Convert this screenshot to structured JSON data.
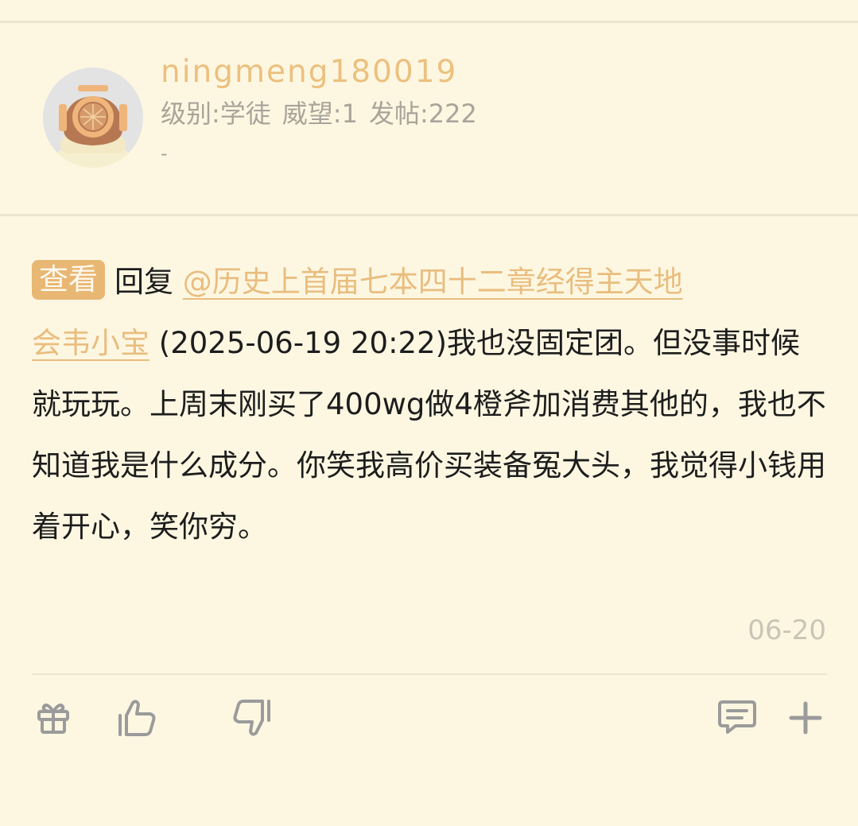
{
  "user": {
    "name": "ningmeng180019",
    "level": "级别:学徒",
    "prestige": "威望:1",
    "posts": "发帖:222",
    "signature": "-"
  },
  "post": {
    "view_label": "查看",
    "reply_label": "回复",
    "mention_line1": "@历史上首届七本四十二章经得主天地",
    "mention_line2": "会韦小宝",
    "quote_time": " (2025-06-19 20:22)",
    "body": "我也没固定团。但没事时候就玩玩。上周末刚买了400wg做4橙斧加消费其他的，我也不知道我是什么成分。你笑我高价买装备冤大头，我觉得小钱用着开心，笑你穷。",
    "date": "06-20"
  },
  "actions": {
    "icons": [
      "gift-icon",
      "thumbs-up-icon",
      "thumbs-down-icon",
      "comment-icon",
      "plus-icon"
    ]
  },
  "colors": {
    "background": "#fdf7e2",
    "accent": "#e9b774",
    "username": "#ecc07e",
    "icon": "#9b9b9b"
  }
}
